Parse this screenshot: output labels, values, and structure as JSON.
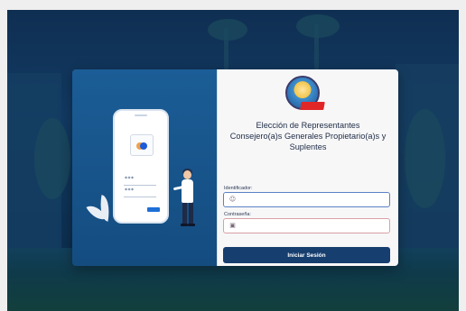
{
  "form": {
    "title_line1": "Elección de Representantes",
    "title_line2": "Consejero(a)s Generales Propietario(a)s y",
    "title_line3": "Suplentes",
    "identifier_label": "Identificador:",
    "identifier_value": "",
    "password_label": "Contraseña:",
    "password_value": "",
    "submit_label": "Iniciar Sesión"
  },
  "illustration": {
    "password_stars_1": "***",
    "password_stars_2": "***"
  },
  "icons": {
    "user": "user-circle-icon",
    "lock": "lock-icon"
  },
  "colors": {
    "panel_blue": "#1b5d96",
    "button_navy": "#163e6e",
    "accent_red": "#e02626"
  }
}
